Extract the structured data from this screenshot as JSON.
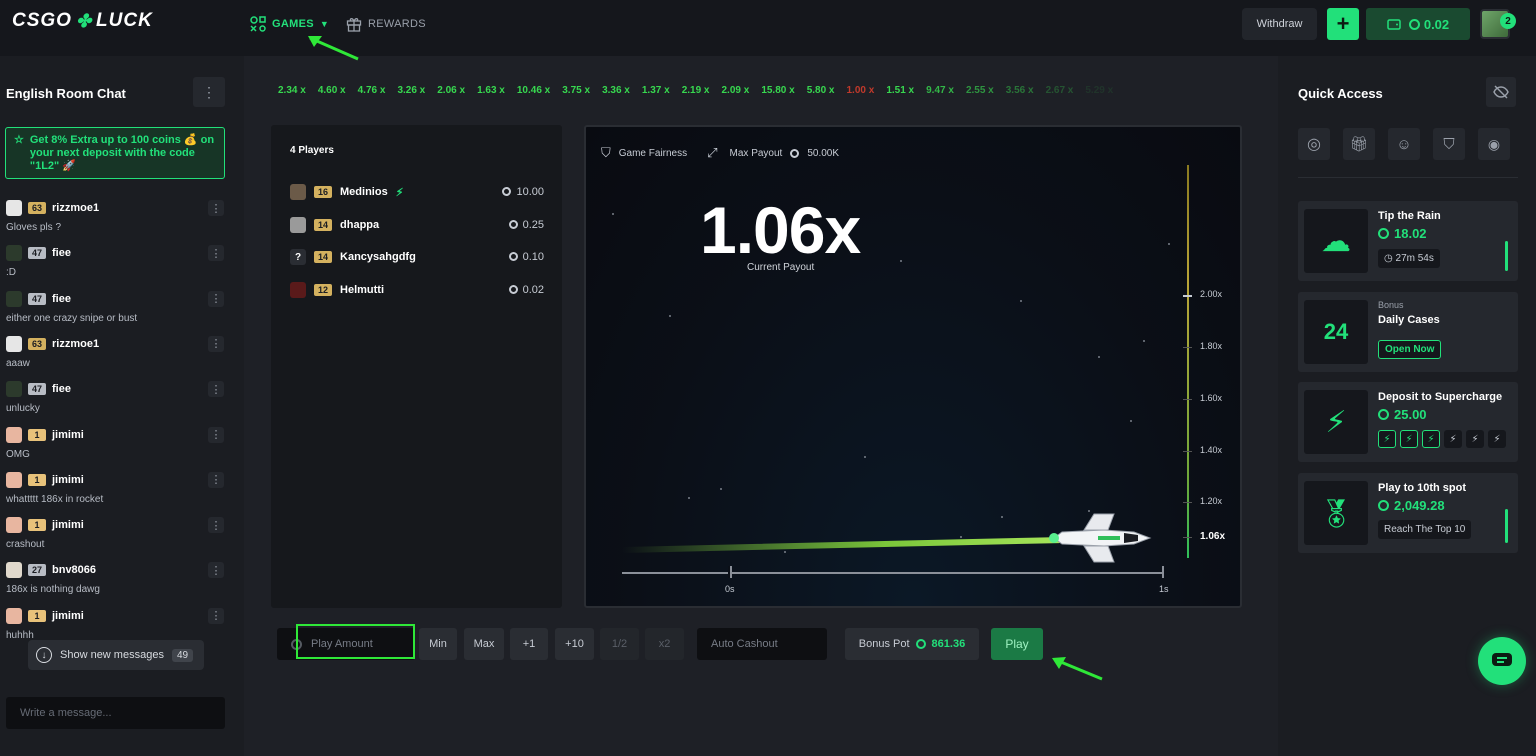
{
  "header": {
    "logo": "CSGOLUCK",
    "nav_games": "GAMES",
    "nav_rewards": "REWARDS",
    "withdraw": "Withdraw",
    "plus": "+",
    "balance": "0.02",
    "avatar_badge": "2"
  },
  "chat": {
    "title": "English Room Chat",
    "promo": "Get 8% Extra up to 100 coins 💰 on your next deposit with the code \"1L2\" 🚀",
    "messages": [
      {
        "user": "rizzmoe1",
        "level": "63",
        "text": "Gloves pls ?"
      },
      {
        "user": "fiee",
        "level": "47",
        "text": ":D"
      },
      {
        "user": "fiee",
        "level": "47",
        "text": "either one crazy snipe or bust"
      },
      {
        "user": "rizzmoe1",
        "level": "63",
        "text": "aaaw"
      },
      {
        "user": "fiee",
        "level": "47",
        "text": "unlucky"
      },
      {
        "user": "jimimi",
        "level": "1",
        "text": "OMG"
      },
      {
        "user": "jimimi",
        "level": "1",
        "text": "whattttt 186x in rocket"
      },
      {
        "user": "jimimi",
        "level": "1",
        "text": "crashout"
      },
      {
        "user": "bnv8066",
        "level": "27",
        "text": "186x is nothing dawg"
      },
      {
        "user": "jimimi",
        "level": "1",
        "text": "huhhh"
      }
    ],
    "show_new": "Show new messages",
    "new_count": "49",
    "input_placeholder": "Write a message..."
  },
  "history": [
    "2.34 x",
    "4.60 x",
    "4.76 x",
    "3.26 x",
    "2.06 x",
    "1.63 x",
    "10.46 x",
    "3.75 x",
    "3.36 x",
    "1.37 x",
    "2.19 x",
    "2.09 x",
    "15.80 x",
    "5.80 x",
    "1.00 x",
    "1.51 x",
    "9.47 x",
    "2.55 x",
    "3.56 x",
    "2.67 x",
    "5.29 x"
  ],
  "players": {
    "count": "4 Players",
    "list": [
      {
        "name": "Medinios",
        "level": "16",
        "amount": "10.00"
      },
      {
        "name": "dhappa",
        "level": "14",
        "amount": "0.25"
      },
      {
        "name": "Kancysahgdfg",
        "level": "14",
        "amount": "0.10"
      },
      {
        "name": "Helmutti",
        "level": "12",
        "amount": "0.02"
      }
    ]
  },
  "game": {
    "fairness": "Game Fairness",
    "max_payout_label": "Max Payout",
    "max_payout": "50.00K",
    "multiplier": "1.06x",
    "multiplier_label": "Current Payout",
    "y_ticks": [
      "2.00x",
      "1.80x",
      "1.60x",
      "1.40x",
      "1.20x",
      "1.06x"
    ],
    "x_ticks": [
      "0s",
      "1s"
    ]
  },
  "controls": {
    "amount_placeholder": "Play Amount",
    "min": "Min",
    "max": "Max",
    "plus1": "+1",
    "plus10": "+10",
    "half": "1/2",
    "double": "x2",
    "auto_cashout": "Auto Cashout",
    "bonus_label": "Bonus Pot",
    "bonus_value": "861.36",
    "play": "Play"
  },
  "quick_access": {
    "title": "Quick Access",
    "cards": [
      {
        "title": "Tip the Rain",
        "value": "18.02",
        "pill": "27m 54s"
      },
      {
        "overline": "Bonus",
        "title": "Daily Cases",
        "action": "Open Now"
      },
      {
        "title": "Deposit to Supercharge",
        "value": "25.00"
      },
      {
        "title": "Play to 10th spot",
        "value": "2,049.28",
        "pill": "Reach The Top 10"
      }
    ]
  },
  "colors": {
    "accent": "#22e07a",
    "background": "#15171c",
    "panel": "#1b1d22"
  }
}
